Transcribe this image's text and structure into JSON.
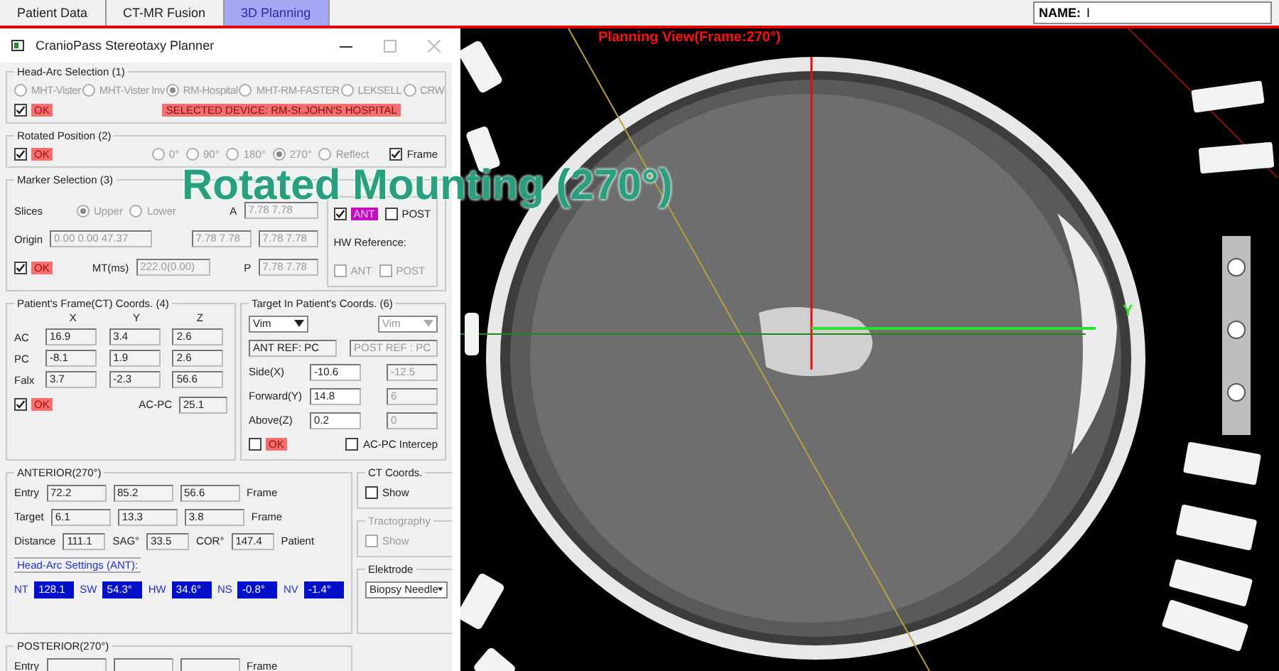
{
  "tabs": [
    {
      "label": "Patient Data",
      "selected": false
    },
    {
      "label": "CT-MR Fusion",
      "selected": false
    },
    {
      "label": "3D Planning",
      "selected": true
    }
  ],
  "name_field": {
    "label": "NAME:",
    "value": "I"
  },
  "planner": {
    "title": "CranioPass Stereotaxy Planner",
    "head_arc": {
      "title": "Head-Arc Selection (1)",
      "devices": [
        {
          "label": "MHT-Vister",
          "selected": false,
          "disabled": true
        },
        {
          "label": "MHT-Vister Inv",
          "selected": false,
          "disabled": true
        },
        {
          "label": "RM-Hospital",
          "selected": true,
          "disabled": true
        },
        {
          "label": "MHT-RM-FASTER",
          "selected": false,
          "disabled": true
        },
        {
          "label": "LEKSELL",
          "selected": false,
          "disabled": true
        },
        {
          "label": "CRW",
          "selected": false,
          "disabled": true
        }
      ],
      "ok": {
        "label": "OK",
        "checked": true
      },
      "selected_device": "SELECTED DEVICE: RM-St.JOHN'S HOSPITAL"
    },
    "rotated": {
      "title": "Rotated Position (2)",
      "ok": {
        "label": "OK",
        "checked": true
      },
      "angles": [
        {
          "label": "0°",
          "selected": false,
          "disabled": true
        },
        {
          "label": "90°",
          "selected": false,
          "disabled": true
        },
        {
          "label": "180°",
          "selected": false,
          "disabled": true
        },
        {
          "label": "270°",
          "selected": true,
          "disabled": true
        },
        {
          "label": "Reflect",
          "selected": false,
          "disabled": true
        }
      ],
      "frame": {
        "label": "Frame",
        "checked": true
      }
    },
    "marker": {
      "title": "Marker Selection (3)",
      "slices_label": "Slices",
      "slices": [
        {
          "label": "Upper",
          "selected": true,
          "disabled": true
        },
        {
          "label": "Lower",
          "selected": false,
          "disabled": true
        }
      ],
      "a_label": "A",
      "a_value": "7.78  7.78",
      "origin_label": "Origin",
      "origin_value": "0.00   0.00   47.37",
      "fields": [
        "7.78  7.78",
        "7.78  7.78"
      ],
      "ok": {
        "label": "OK",
        "checked": true
      },
      "mt_label": "MT(ms)",
      "mt_value": "222.0(0.00)",
      "p_label": "P",
      "p_value": "7.78  7.78",
      "ant": {
        "label": "ANT",
        "checked": true
      },
      "post": {
        "label": "POST",
        "checked": false
      },
      "hw_reference": "HW Reference:",
      "hw_options": [
        {
          "label": "ANT",
          "checked": false,
          "disabled": true
        },
        {
          "label": "POST",
          "checked": false,
          "disabled": true
        }
      ]
    },
    "patient_frame": {
      "title": "Patient's Frame(CT) Coords. (4)",
      "columns": [
        "X",
        "Y",
        "Z"
      ],
      "rows": [
        {
          "label": "AC",
          "values": [
            "16.9",
            "3.4",
            "2.6"
          ]
        },
        {
          "label": "PC",
          "values": [
            "-8.1",
            "1.9",
            "2.6"
          ]
        },
        {
          "label": "Falx",
          "values": [
            "3.7",
            "-2.3",
            "56.6"
          ]
        }
      ],
      "ok": {
        "label": "OK",
        "checked": true
      },
      "acpc_label": "AC-PC",
      "acpc_value": "25.1"
    },
    "target": {
      "title": "Target In Patient's Coords. (6)",
      "dropdowns": [
        {
          "value": "Vim",
          "disabled": false
        },
        {
          "value": "Vim",
          "disabled": true
        }
      ],
      "refs": [
        {
          "value": "ANT REF: PC",
          "disabled": false
        },
        {
          "value": "POST REF : PC",
          "disabled": true
        }
      ],
      "rows": [
        {
          "label": "Side(X)",
          "values": [
            "-10.6",
            "-12.5"
          ]
        },
        {
          "label": "Forward(Y)",
          "values": [
            "14.8",
            "6"
          ]
        },
        {
          "label": "Above(Z)",
          "values": [
            "0.2",
            "0"
          ]
        }
      ],
      "ok": {
        "label": "OK",
        "checked": false
      },
      "intercep": {
        "label": "AC-PC Intercep",
        "checked": false
      }
    },
    "anterior": {
      "title": "ANTERIOR(270°)",
      "rows": [
        {
          "label": "Entry",
          "values": [
            "72.2",
            "85.2",
            "56.6"
          ],
          "unit": "Frame"
        },
        {
          "label": "Target",
          "values": [
            "6.1",
            "13.3",
            "3.8"
          ],
          "unit": "Frame"
        }
      ],
      "distance": {
        "label": "Distance",
        "value": "111.1"
      },
      "sag": {
        "label": "SAG°",
        "value": "33.5"
      },
      "cor": {
        "label": "COR°",
        "value": "147.4"
      },
      "patient": "Patient",
      "settings_title": "Head-Arc Settings (ANT):",
      "settings": [
        {
          "label": "NT",
          "value": "128.1"
        },
        {
          "label": "SW",
          "value": "54.3°"
        },
        {
          "label": "HW",
          "value": "34.6°"
        },
        {
          "label": "NS",
          "value": "-0.8°"
        },
        {
          "label": "NV",
          "value": "-1.4°"
        }
      ]
    },
    "ct_coords": {
      "title": "CT Coords.",
      "show": {
        "label": "Show",
        "checked": false
      }
    },
    "tractography": {
      "title": "Tractography",
      "show": {
        "label": "Show",
        "checked": false,
        "disabled": true
      }
    },
    "elektrode": {
      "title": "Elektrode",
      "value": "Biopsy Needle"
    },
    "posterior": {
      "title": "POSTERIOR(270°)",
      "entry_label": "Entry",
      "unit": "Frame"
    }
  },
  "viewer": {
    "title": "Planning View(Frame:270°)",
    "axis_label": "Y"
  },
  "overlay": "Rotated Mounting (270°)"
}
